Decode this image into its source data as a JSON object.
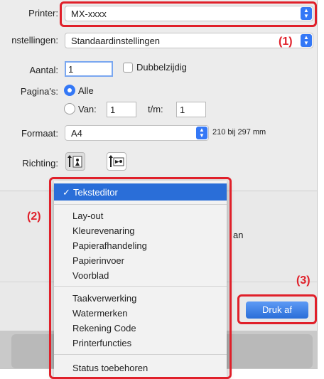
{
  "printer": {
    "label": "Printer:",
    "value": "MX-xxxx"
  },
  "presets": {
    "label": "nstellingen:",
    "value": "Standaardinstellingen"
  },
  "copies": {
    "label": "Aantal:",
    "value": "1",
    "duplex_label": "Dubbelzijdig"
  },
  "pages": {
    "label": "Pagina's:",
    "all_label": "Alle",
    "from_label": "Van:",
    "from_value": "1",
    "to_label": "t/m:",
    "to_value": "1"
  },
  "paper": {
    "label": "Formaat:",
    "value": "A4",
    "size_text": "210 bij 297 mm"
  },
  "orientation": {
    "label": "Richting:"
  },
  "menu": {
    "selected": "Teksteditor",
    "group1": [
      "Lay-out",
      "Kleurevenaring",
      "Papierafhandeling",
      "Papierinvoer",
      "Voorblad"
    ],
    "group2": [
      "Taakverwerking",
      "Watermerken",
      "Rekening Code",
      "Printerfuncties"
    ],
    "group3": [
      "Status toebehoren"
    ]
  },
  "hidden_text_fragment": "an",
  "print_button": "Druk af",
  "callouts": {
    "c1": "(1)",
    "c2": "(2)",
    "c3": "(3)"
  },
  "colors": {
    "accent": "#3478f6",
    "highlight": "#2a6ed8",
    "callout_red": "#e0202a"
  }
}
